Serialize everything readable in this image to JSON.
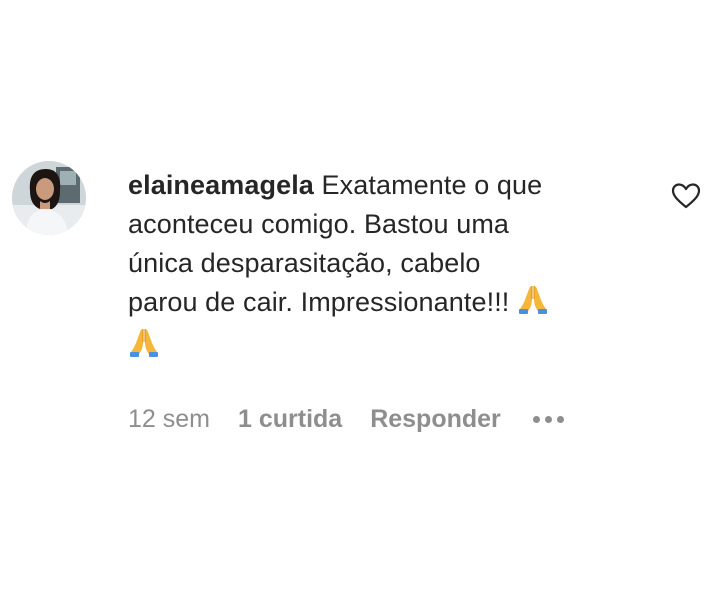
{
  "comment": {
    "username": "elaineamagela",
    "text_line1": "Exatamente o que",
    "text_line2": "aconteceu comigo. Bastou uma",
    "text_line3": "única desparasitação, cabelo",
    "text_line4": "parou de cair. Impressionante!!!",
    "emoji_1": "🙏",
    "emoji_2": "🙏",
    "time": "12 sem",
    "likes": "1 curtida",
    "reply_label": "Responder"
  },
  "icons": {
    "like": "heart-outline-icon",
    "more": "more-horizontal-icon",
    "avatar": "profile-photo"
  },
  "colors": {
    "text": "#262626",
    "muted": "#8e8e8e",
    "emoji": "#f5a623"
  }
}
